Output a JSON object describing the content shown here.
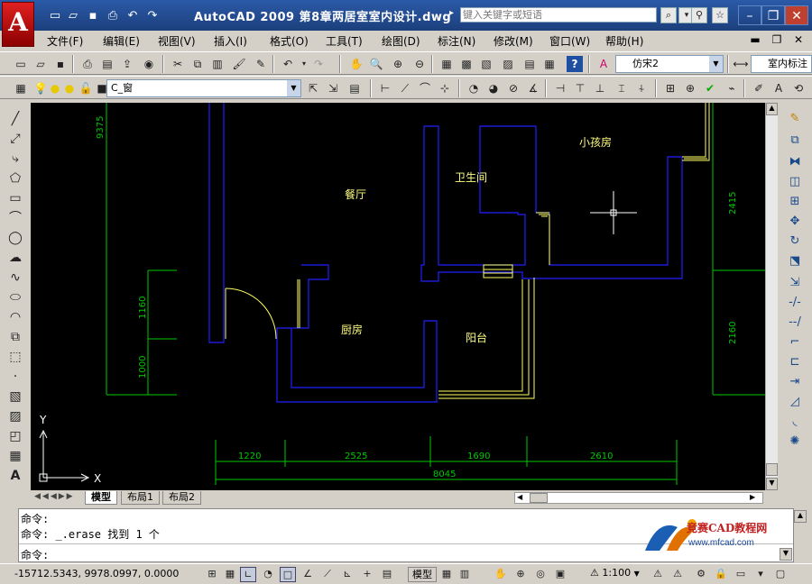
{
  "title_bar": {
    "app_logo": "A",
    "title": "AutoCAD 2009  第8章两居室室内设计.dwg",
    "search_placeholder": "键入关键字或短语"
  },
  "menu": [
    "文件(F)",
    "编辑(E)",
    "视图(V)",
    "插入(I)",
    "格式(O)",
    "工具(T)",
    "绘图(D)",
    "标注(N)",
    "修改(M)",
    "窗口(W)",
    "帮助(H)"
  ],
  "toolbar": {
    "text_style": "仿宋2",
    "dim_style": "室内标注",
    "layer": "C_窗"
  },
  "drawing": {
    "rooms": [
      "餐厅",
      "卫生间",
      "小孩房",
      "厨房",
      "阳台"
    ],
    "dims_bottom": [
      "1220",
      "2525",
      "1690",
      "2610"
    ],
    "dim_total": "8045",
    "dims_left": [
      "9375",
      "1160",
      "1000"
    ],
    "dims_right": [
      "2415",
      "2160"
    ],
    "ucs_x": "X",
    "ucs_y": "Y"
  },
  "layout_tabs": [
    "模型",
    "布局1",
    "布局2"
  ],
  "command": {
    "line1": "命令:",
    "line2": "命令: _.erase 找到 1 个",
    "prompt": "命令:",
    "watermark_name": "竞赛CAD教程网",
    "watermark_url": "www.mfcad.com"
  },
  "status": {
    "coords": "-15712.5343,  9978.0997,  0.0000",
    "model_label": "模型",
    "scale": "1:100"
  },
  "colors": {
    "wall": "#0000ff",
    "dim": "#00c800",
    "text": "#ffff80",
    "door": "#ffff00",
    "background": "#000000"
  }
}
